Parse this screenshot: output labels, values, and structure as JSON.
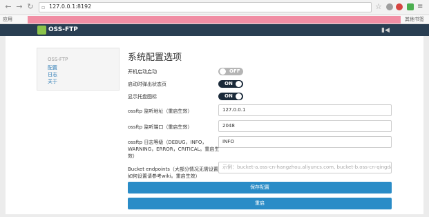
{
  "browser": {
    "url": "127.0.0.1:8192",
    "bookmark_left": "应用",
    "bookmark_right": "其他书签"
  },
  "app": {
    "logo_text": "OSS-FTP"
  },
  "sidebar": {
    "header": "OSS-FTP",
    "items": [
      {
        "label": "配置"
      },
      {
        "label": "日志"
      },
      {
        "label": "关于"
      }
    ]
  },
  "main": {
    "title": "系统配置选项",
    "settings": {
      "autostart": {
        "label": "开机启动启动",
        "state": "OFF"
      },
      "status_popup": {
        "label": "启动时弹出状态页",
        "state": "ON"
      },
      "tray_icon": {
        "label": "显示托盘图标",
        "state": "ON"
      }
    },
    "fields": {
      "listen_address": {
        "label": "ossftp 监听地址（重启生效）",
        "value": "127.0.0.1"
      },
      "listen_port": {
        "label": "ossftp 监听端口（重启生效）",
        "value": "2048"
      },
      "log_level": {
        "label_line1": "ossftp 日志等级（DEBUG，INFO，",
        "label_line2": "WARNING，ERROR，CRITICAL。重启生",
        "label_line3": "效）",
        "value": "INFO"
      },
      "bucket_endpoints": {
        "label_line1": "Bucket endpoints（大部分情况无需设置，",
        "label_line2": "如何设置请参考wiki。重启生效）",
        "placeholder": "示例：bucket-a.oss-cn-hangzhou.aliyuncs.com, bucket-b.oss-cn-qingdao.aliyuncs.com"
      }
    },
    "save_label": "保存配置",
    "restart_label": "重启"
  },
  "colors": {
    "appbar": "#293e52",
    "button": "#2a8cc7",
    "toggle_on": "#1b2a3a",
    "toggle_off": "#b5b5b5",
    "link": "#2a7ab5"
  }
}
